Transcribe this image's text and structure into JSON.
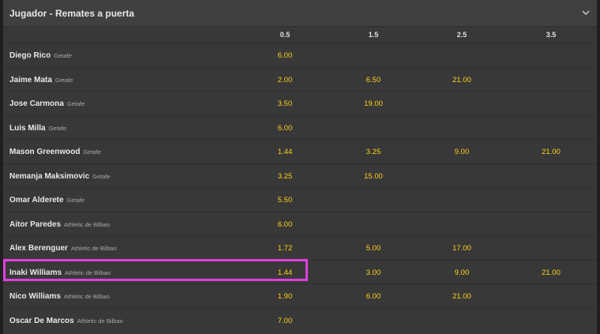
{
  "header": {
    "title": "Jugador - Remates a puerta",
    "collapse_icon": "chevron-down-icon"
  },
  "columns": [
    "0.5",
    "1.5",
    "2.5",
    "3.5"
  ],
  "rows": [
    {
      "name": "Diego Rico",
      "team": "Getafe",
      "odds": [
        "6.00",
        "",
        "",
        ""
      ]
    },
    {
      "name": "Jaime Mata",
      "team": "Getafe",
      "odds": [
        "2.00",
        "6.50",
        "21.00",
        ""
      ]
    },
    {
      "name": "Jose Carmona",
      "team": "Getafe",
      "odds": [
        "3.50",
        "19.00",
        "",
        ""
      ]
    },
    {
      "name": "Luis Milla",
      "team": "Getafe",
      "odds": [
        "6.00",
        "",
        "",
        ""
      ]
    },
    {
      "name": "Mason Greenwood",
      "team": "Getafe",
      "odds": [
        "1.44",
        "3.25",
        "9.00",
        "21.00"
      ]
    },
    {
      "name": "Nemanja Maksimovic",
      "team": "Getafe",
      "odds": [
        "3.25",
        "15.00",
        "",
        ""
      ]
    },
    {
      "name": "Omar Alderete",
      "team": "Getafe",
      "odds": [
        "5.50",
        "",
        "",
        ""
      ]
    },
    {
      "name": "Aitor Paredes",
      "team": "Athletic de Bilbao",
      "odds": [
        "6.00",
        "",
        "",
        ""
      ]
    },
    {
      "name": "Alex Berenguer",
      "team": "Athletic de Bilbao",
      "odds": [
        "1.72",
        "5.00",
        "17.00",
        ""
      ]
    },
    {
      "name": "Inaki Williams",
      "team": "Athletic de Bilbao",
      "odds": [
        "1.44",
        "3.00",
        "9.00",
        "21.00"
      ]
    },
    {
      "name": "Nico Williams",
      "team": "Athletic de Bilbao",
      "odds": [
        "1.90",
        "6.00",
        "21.00",
        ""
      ]
    },
    {
      "name": "Oscar De Marcos",
      "team": "Athletic de Bilbao",
      "odds": [
        "7.00",
        "",
        "",
        ""
      ]
    }
  ],
  "colors": {
    "odds": "#ffd21a",
    "highlight": "#e040e0",
    "background": "#383838"
  }
}
